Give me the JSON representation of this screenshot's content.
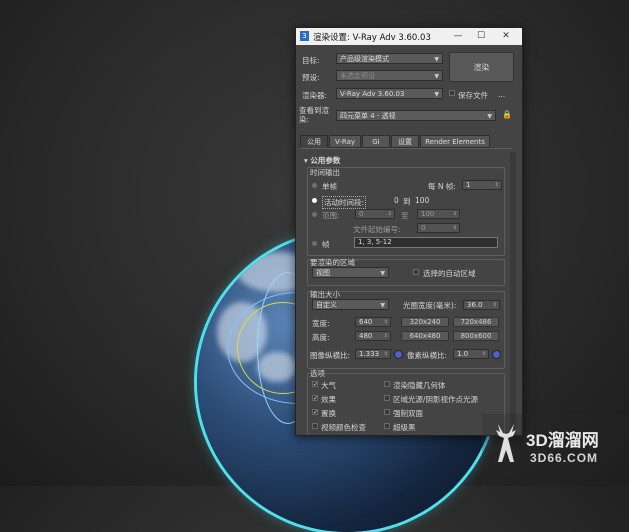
{
  "window": {
    "title": "渲染设置: V-Ray Adv 3.60.03",
    "minimize": "—",
    "maximize": "☐",
    "close": "✕"
  },
  "header": {
    "target_label": "目标:",
    "target_value": "产品级渲染模式",
    "preset_label": "预设:",
    "preset_value": "未选定预设",
    "renderer_label": "渲染器:",
    "renderer_value": "V-Ray Adv 3.60.03",
    "save_file_label": "保存文件",
    "dots": "...",
    "view_label": "查看到渲染:",
    "view_value": "四元菜单 4 - 透视",
    "render_button": "渲染",
    "lock_icon": "lock-icon"
  },
  "tabs": [
    "公用",
    "V-Ray",
    "GI",
    "设置",
    "Render Elements"
  ],
  "common": {
    "rollout_title": "公用参数",
    "time_output": {
      "title": "时间输出",
      "single": "单帧",
      "every_n_label": "每 N 帧:",
      "every_n_value": "1",
      "active_segment": "活动时间段:",
      "active_from": "0",
      "active_to_label": "到",
      "active_to": "100",
      "range": "范围:",
      "range_from": "0",
      "range_to_label": "至",
      "range_to": "100",
      "file_start_label": "文件起始编号:",
      "file_start_value": "0",
      "frames": "帧",
      "frames_value": "1, 3, 5-12"
    },
    "area": {
      "title": "要渲染的区域",
      "value": "视图",
      "auto_region": "选择的自动区域"
    },
    "output_size": {
      "title": "输出大小",
      "preset": "自定义",
      "aperture_label": "光圈宽度(毫米):",
      "aperture_value": "36.0",
      "width_label": "宽度:",
      "width_value": "640",
      "height_label": "高度:",
      "height_value": "480",
      "presets": [
        "320x240",
        "720x486",
        "640x480",
        "800x600"
      ],
      "image_aspect_label": "图像纵横比:",
      "image_aspect_value": "1.333",
      "pixel_aspect_label": "像素纵横比:",
      "pixel_aspect_value": "1.0"
    },
    "options": {
      "title": "选项",
      "items": [
        {
          "label": "大气",
          "checked": true
        },
        {
          "label": "渲染隐藏几何体",
          "checked": false
        },
        {
          "label": "效果",
          "checked": true
        },
        {
          "label": "区域光源/阴影视作点光源",
          "checked": false
        },
        {
          "label": "置换",
          "checked": true
        },
        {
          "label": "强制双面",
          "checked": false
        },
        {
          "label": "视频颜色检查",
          "checked": false
        },
        {
          "label": "超级黑",
          "checked": false
        }
      ]
    }
  },
  "watermark": {
    "brand": "3D溜溜网",
    "url": "3D66.COM"
  }
}
